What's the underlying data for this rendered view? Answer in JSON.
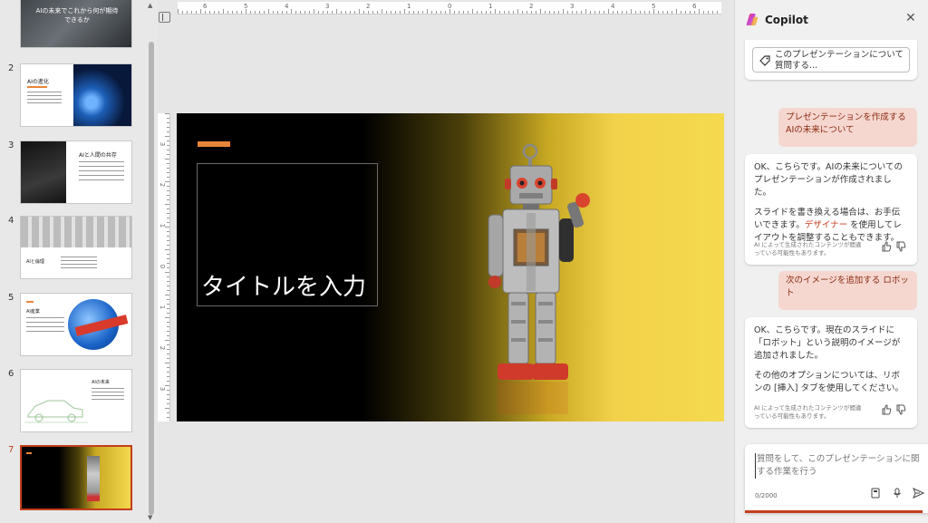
{
  "app": {
    "accent": "#c43e1c"
  },
  "thumbnails": [
    {
      "num": "",
      "title": "AIの未来でこれから何が期待できるか"
    },
    {
      "num": "2",
      "title": "AIの進化"
    },
    {
      "num": "3",
      "title": "AIと人間の共存"
    },
    {
      "num": "4",
      "title": "AIと倫理"
    },
    {
      "num": "5",
      "title": "AI産業"
    },
    {
      "num": "6",
      "title": "AIの未来"
    },
    {
      "num": "7",
      "title": ""
    }
  ],
  "ruler": {
    "h_labels": [
      "6",
      "5",
      "4",
      "3",
      "2",
      "1",
      "0",
      "1",
      "2",
      "3",
      "4",
      "5",
      "6"
    ],
    "v_labels": [
      "3",
      "2",
      "1",
      "0",
      "1",
      "2",
      "3"
    ]
  },
  "slide": {
    "title_placeholder": "タイトルを入力",
    "accent_color": "#e8843a",
    "image": "robot-image"
  },
  "copilot": {
    "title": "Copilot",
    "close_icon": "close-icon",
    "prompt_chip": "このプレゼンテーションについて質問する...",
    "messages": [
      {
        "role": "user",
        "text": "プレゼンテーションを作成する AIの未来について"
      },
      {
        "role": "assistant",
        "para1": "OK、こちらです。AIの未来についてのプレゼンテーションが作成されました。",
        "para2_a": "スライドを書き換える場合は、お手伝いできます。",
        "para2_link": "デザイナー",
        "para2_b": " を使用してレイアウトを調整することもできます。",
        "disclaimer": "AI によって生成されたコンテンツが間違っている可能性もあります。"
      },
      {
        "role": "user",
        "text": "次のイメージを追加する ロボット"
      },
      {
        "role": "assistant",
        "para1": "OK、こちらです。現在のスライドに「ロボット」という説明のイメージが追加されました。",
        "para2": "その他のオプションについては、リボンの [挿入] タブを使用してください。",
        "disclaimer": "AI によって生成されたコンテンツが間違っている可能性もあります。"
      }
    ],
    "input": {
      "placeholder": "質問をして、このプレゼンテーションに関する作業を行う",
      "char_count": "0/2000"
    }
  }
}
